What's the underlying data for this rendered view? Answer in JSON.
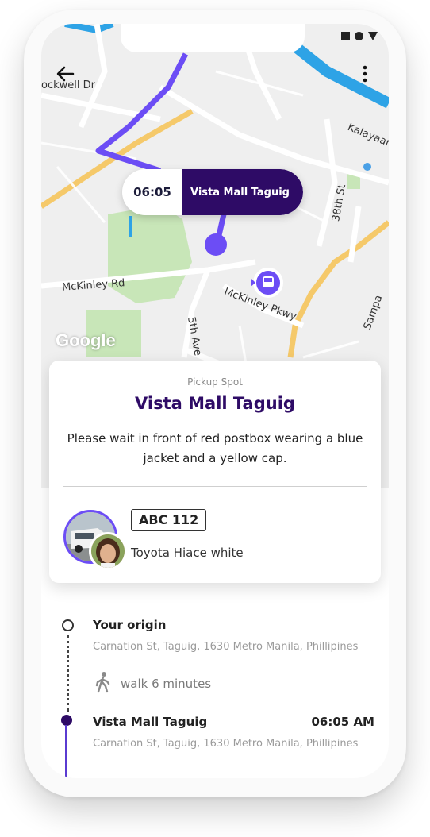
{
  "map": {
    "streets": {
      "rockwell": "ockwell Dr",
      "kalayaan": "Kalayaan A",
      "street_38th": "38th St",
      "mckinley_rd": "McKinley Rd",
      "mckinley_pkwy": "McKinley Pkwy",
      "fifth_ave": "5th Ave",
      "sampa": "Sampa"
    },
    "google": "Google",
    "route_color": "#6c4df5",
    "water_color": "#2ea3e6"
  },
  "bubble": {
    "time": "06:05",
    "place": "Vista Mall Taguig"
  },
  "card": {
    "subtitle": "Pickup Spot",
    "title": "Vista Mall Taguig",
    "description": "Please wait in front of red postbox wearing a blue jacket and a yellow cap.",
    "plate": "ABC 112",
    "vehicle": "Toyota Hiace white"
  },
  "timeline": {
    "origin_title": "Your origin",
    "origin_address": "Carnation St, Taguig, 1630 Metro Manila, Phillipines",
    "walk": "walk 6 minutes",
    "dest_title": "Vista Mall Taguig",
    "dest_time": "06:05 AM",
    "dest_address": "Carnation St, Taguig, 1630 Metro Manila, Phillipines"
  },
  "colors": {
    "brand_dark": "#2e0b66",
    "accent": "#6c4df5"
  }
}
